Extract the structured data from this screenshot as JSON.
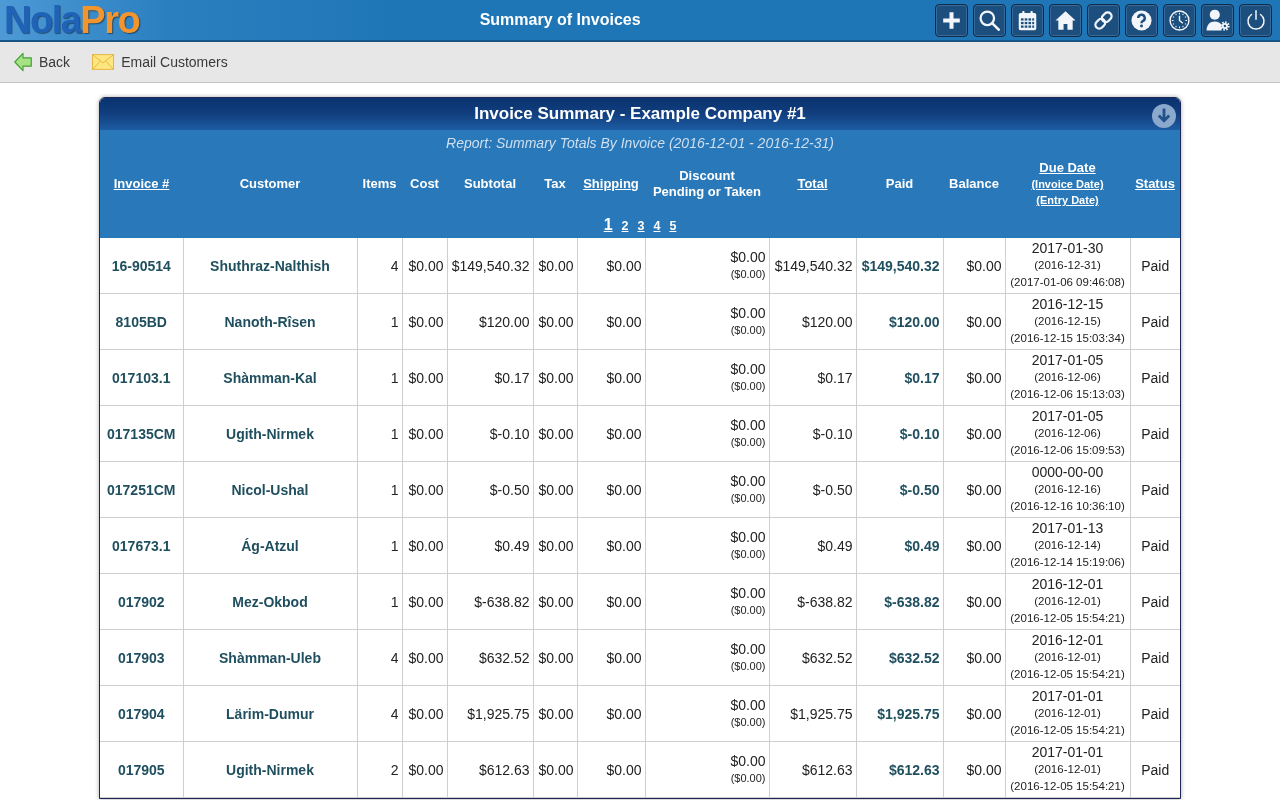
{
  "app_bar": {
    "logo": [
      "Nola",
      "Pro"
    ],
    "title": "Summary of Invoices"
  },
  "toolbar": {
    "actions": [
      {
        "label": "Back",
        "kind": "back"
      },
      {
        "label": "Email Customers",
        "kind": "email"
      }
    ]
  },
  "report": {
    "title": "Invoice Summary - Example Company #1",
    "subtitle": "Report: Summary Totals By Invoice (2016-12-01 - 2016-12-31)",
    "columns": [
      {
        "lines": [
          "Invoice #"
        ],
        "sortable": true
      },
      {
        "lines": [
          "Customer"
        ],
        "sortable": false
      },
      {
        "lines": [
          "Items"
        ],
        "sortable": false
      },
      {
        "lines": [
          "Cost"
        ],
        "sortable": false
      },
      {
        "lines": [
          "Subtotal"
        ],
        "sortable": false
      },
      {
        "lines": [
          "Tax"
        ],
        "sortable": false
      },
      {
        "lines": [
          "Shipping"
        ],
        "sortable": true
      },
      {
        "lines": [
          "Discount",
          "Pending or Taken"
        ],
        "sortable": false
      },
      {
        "lines": [
          "Total"
        ],
        "sortable": true
      },
      {
        "lines": [
          "Paid"
        ],
        "sortable": false
      },
      {
        "lines": [
          "Balance"
        ],
        "sortable": false
      },
      {
        "lines": [
          "Due Date",
          "(Invoice Date)",
          "(Entry Date)"
        ],
        "sortable": true
      },
      {
        "lines": [
          "Status"
        ],
        "sortable": true
      }
    ],
    "pages": [
      {
        "label": "1",
        "selected": true
      },
      {
        "label": "2",
        "selected": false
      },
      {
        "label": "3",
        "selected": false
      },
      {
        "label": "4",
        "selected": false
      },
      {
        "label": "5",
        "selected": false
      }
    ],
    "rows": [
      {
        "invoice": "16-90514",
        "customer": "Shuthraz-Nalthish",
        "items": "4",
        "cost": "$0.00",
        "subtotal": "$149,540.32",
        "tax": "$0.00",
        "shipping": "$0.00",
        "discount": "$0.00",
        "discount_detail": "($0.00)",
        "total": "$149,540.32",
        "paid": "$149,540.32",
        "balance": "$0.00",
        "due_date": "2017-01-30",
        "invoice_date": "(2016-12-31)",
        "entry_date": "(2017-01-06 09:46:08)",
        "status": "Paid"
      },
      {
        "invoice": "8105BD",
        "customer": "Nanoth-Rîsen",
        "items": "1",
        "cost": "$0.00",
        "subtotal": "$120.00",
        "tax": "$0.00",
        "shipping": "$0.00",
        "discount": "$0.00",
        "discount_detail": "($0.00)",
        "total": "$120.00",
        "paid": "$120.00",
        "balance": "$0.00",
        "due_date": "2016-12-15",
        "invoice_date": "(2016-12-15)",
        "entry_date": "(2016-12-15 15:03:34)",
        "status": "Paid"
      },
      {
        "invoice": "017103.1",
        "customer": "Shàmman-Kal",
        "items": "1",
        "cost": "$0.00",
        "subtotal": "$0.17",
        "tax": "$0.00",
        "shipping": "$0.00",
        "discount": "$0.00",
        "discount_detail": "($0.00)",
        "total": "$0.17",
        "paid": "$0.17",
        "balance": "$0.00",
        "due_date": "2017-01-05",
        "invoice_date": "(2016-12-06)",
        "entry_date": "(2016-12-06 15:13:03)",
        "status": "Paid"
      },
      {
        "invoice": "017135CM",
        "customer": "Ugith-Nirmek",
        "items": "1",
        "cost": "$0.00",
        "subtotal": "$-0.10",
        "tax": "$0.00",
        "shipping": "$0.00",
        "discount": "$0.00",
        "discount_detail": "($0.00)",
        "total": "$-0.10",
        "paid": "$-0.10",
        "balance": "$0.00",
        "due_date": "2017-01-05",
        "invoice_date": "(2016-12-06)",
        "entry_date": "(2016-12-06 15:09:53)",
        "status": "Paid"
      },
      {
        "invoice": "017251CM",
        "customer": "Nicol-Ushal",
        "items": "1",
        "cost": "$0.00",
        "subtotal": "$-0.50",
        "tax": "$0.00",
        "shipping": "$0.00",
        "discount": "$0.00",
        "discount_detail": "($0.00)",
        "total": "$-0.50",
        "paid": "$-0.50",
        "balance": "$0.00",
        "due_date": "0000-00-00",
        "invoice_date": "(2016-12-16)",
        "entry_date": "(2016-12-16 10:36:10)",
        "status": "Paid"
      },
      {
        "invoice": "017673.1",
        "customer": "Ág-Atzul",
        "items": "1",
        "cost": "$0.00",
        "subtotal": "$0.49",
        "tax": "$0.00",
        "shipping": "$0.00",
        "discount": "$0.00",
        "discount_detail": "($0.00)",
        "total": "$0.49",
        "paid": "$0.49",
        "balance": "$0.00",
        "due_date": "2017-01-13",
        "invoice_date": "(2016-12-14)",
        "entry_date": "(2016-12-14 15:19:06)",
        "status": "Paid"
      },
      {
        "invoice": "017902",
        "customer": "Mez-Okbod",
        "items": "1",
        "cost": "$0.00",
        "subtotal": "$-638.82",
        "tax": "$0.00",
        "shipping": "$0.00",
        "discount": "$0.00",
        "discount_detail": "($0.00)",
        "total": "$-638.82",
        "paid": "$-638.82",
        "balance": "$0.00",
        "due_date": "2016-12-01",
        "invoice_date": "(2016-12-01)",
        "entry_date": "(2016-12-05 15:54:21)",
        "status": "Paid"
      },
      {
        "invoice": "017903",
        "customer": "Shàmman-Uleb",
        "items": "4",
        "cost": "$0.00",
        "subtotal": "$632.52",
        "tax": "$0.00",
        "shipping": "$0.00",
        "discount": "$0.00",
        "discount_detail": "($0.00)",
        "total": "$632.52",
        "paid": "$632.52",
        "balance": "$0.00",
        "due_date": "2016-12-01",
        "invoice_date": "(2016-12-01)",
        "entry_date": "(2016-12-05 15:54:21)",
        "status": "Paid"
      },
      {
        "invoice": "017904",
        "customer": "Lärim-Dumur",
        "items": "4",
        "cost": "$0.00",
        "subtotal": "$1,925.75",
        "tax": "$0.00",
        "shipping": "$0.00",
        "discount": "$0.00",
        "discount_detail": "($0.00)",
        "total": "$1,925.75",
        "paid": "$1,925.75",
        "balance": "$0.00",
        "due_date": "2017-01-01",
        "invoice_date": "(2016-12-01)",
        "entry_date": "(2016-12-05 15:54:21)",
        "status": "Paid"
      },
      {
        "invoice": "017905",
        "customer": "Ugith-Nirmek",
        "items": "2",
        "cost": "$0.00",
        "subtotal": "$612.63",
        "tax": "$0.00",
        "shipping": "$0.00",
        "discount": "$0.00",
        "discount_detail": "($0.00)",
        "total": "$612.63",
        "paid": "$612.63",
        "balance": "$0.00",
        "due_date": "2017-01-01",
        "invoice_date": "(2016-12-01)",
        "entry_date": "(2016-12-05 15:54:21)",
        "status": "Paid"
      }
    ]
  }
}
